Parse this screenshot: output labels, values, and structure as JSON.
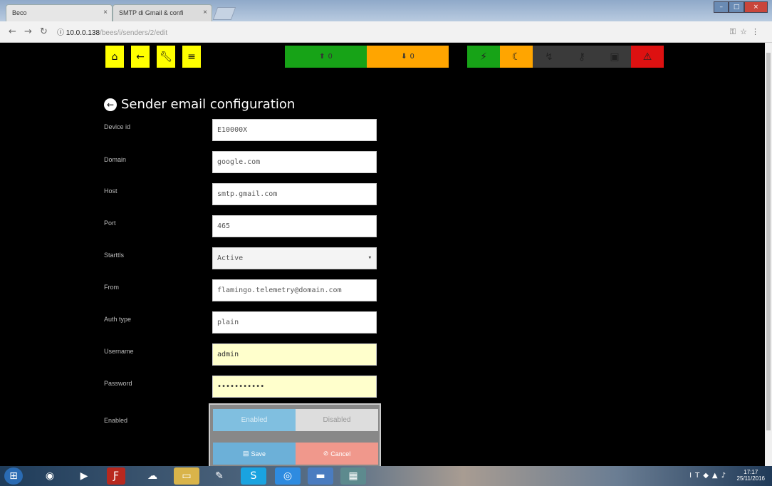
{
  "browser": {
    "tabs": [
      {
        "title": "Beco"
      },
      {
        "title": "SMTP di Gmail & confi"
      }
    ],
    "url_host": "10.0.0.138",
    "url_path": "/bees/i/senders/2/edit"
  },
  "toolbar": {
    "buttons": [
      "home-icon",
      "back-arrow-icon",
      "wrench-icon",
      "menu-icon"
    ],
    "upload_count": "0",
    "download_count": "0",
    "status_icons": [
      {
        "name": "plug-icon",
        "color": "#17a317"
      },
      {
        "name": "moon-icon",
        "color": "#ffa500"
      },
      {
        "name": "bolt-icon",
        "color": "#3a3a3a"
      },
      {
        "name": "key-icon",
        "color": "#3a3a3a"
      },
      {
        "name": "lock-icon",
        "color": "#3a3a3a"
      },
      {
        "name": "warning-icon",
        "color": "#dd1111"
      }
    ]
  },
  "page": {
    "title": "Sender email configuration"
  },
  "form": {
    "device_id": {
      "label": "Device id",
      "value": "E10000X"
    },
    "domain": {
      "label": "Domain",
      "value": "google.com"
    },
    "host": {
      "label": "Host",
      "value": "smtp.gmail.com"
    },
    "port": {
      "label": "Port",
      "value": "465"
    },
    "starttls": {
      "label": "Starttls",
      "value": "Active"
    },
    "from": {
      "label": "From",
      "value": "flamingo.telemetry@domain.com"
    },
    "auth_type": {
      "label": "Auth type",
      "value": "plain"
    },
    "username": {
      "label": "Username",
      "value": "admin"
    },
    "password": {
      "label": "Password",
      "value": "•••••••••••"
    },
    "enabled": {
      "label": "Enabled",
      "on_label": "Enabled",
      "off_label": "Disabled",
      "selected": "Enabled"
    },
    "save_label": "Save",
    "cancel_label": "Cancel"
  },
  "taskbar": {
    "clock_time": "17:17",
    "clock_date": "25/11/2016"
  }
}
